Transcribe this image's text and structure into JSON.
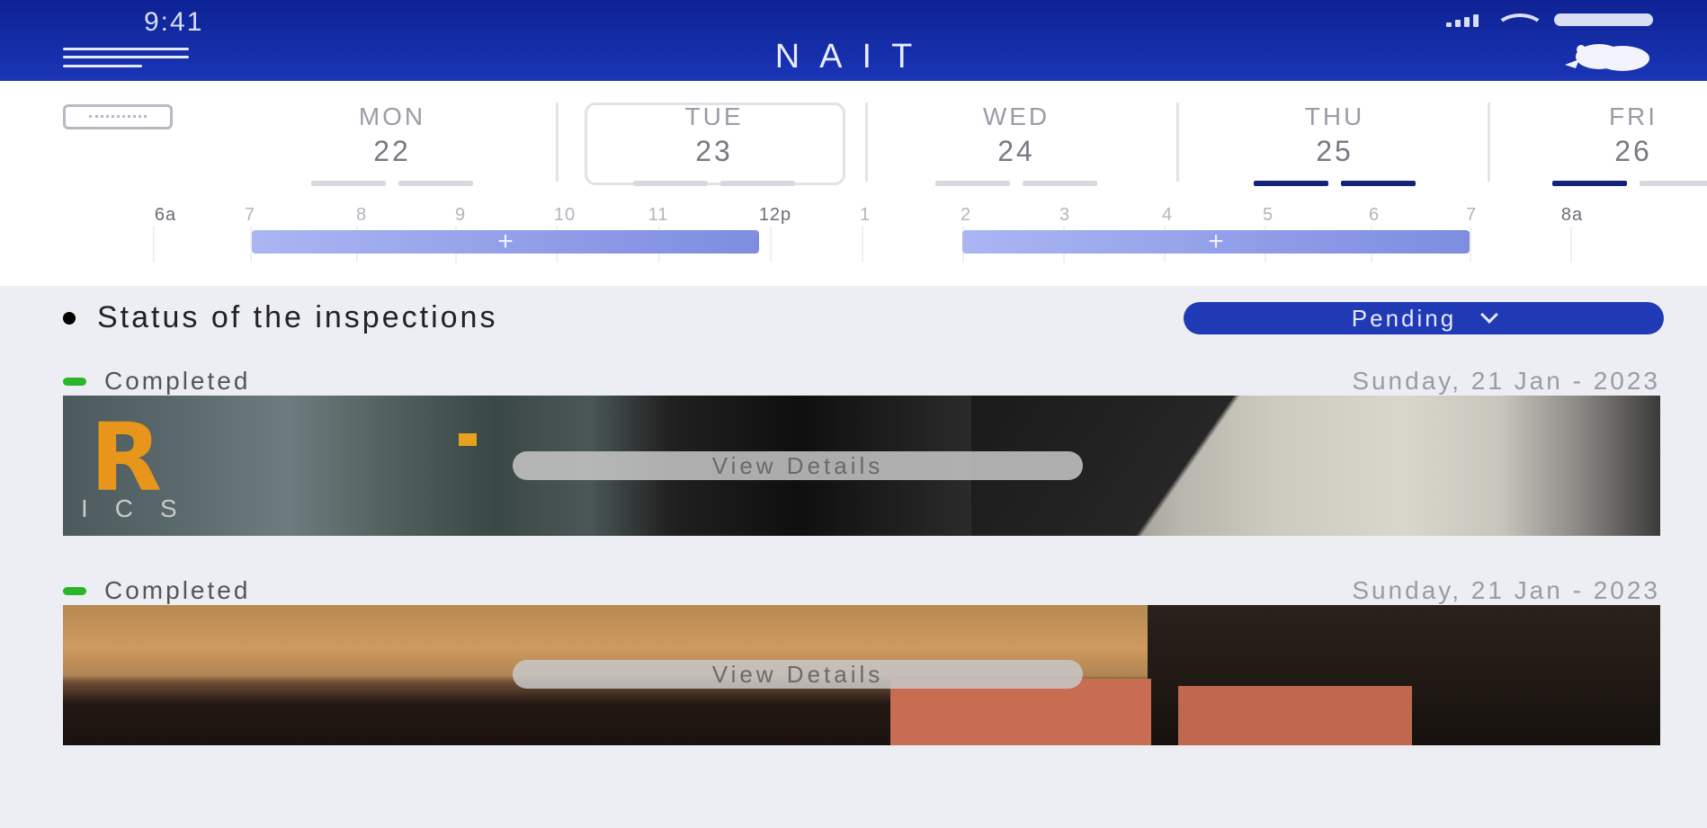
{
  "status_bar": {
    "time": "9:41"
  },
  "header": {
    "brand": "NAIT"
  },
  "calendar": {
    "days": [
      {
        "name": "MON",
        "num": "22"
      },
      {
        "name": "TUE",
        "num": "23"
      },
      {
        "name": "WED",
        "num": "24"
      },
      {
        "name": "THU",
        "num": "25"
      },
      {
        "name": "FRI",
        "num": "26"
      }
    ],
    "selected_day": "TUE",
    "hours": [
      "6a",
      "7",
      "8",
      "9",
      "10",
      "11",
      "12p",
      "1",
      "2",
      "3",
      "4",
      "5",
      "6",
      "7",
      "8a"
    ],
    "slot_plus": "+",
    "colors": {
      "accent": "#1a35b6",
      "slot": "#8a98e6",
      "bar_active": "#14237a"
    }
  },
  "inspections": {
    "title": "Status of the inspections",
    "filter_label": "Pending",
    "items": [
      {
        "state": "Completed",
        "date": "Sunday, 21 Jan - 2023",
        "action": "View Details",
        "photo_text": "R",
        "photo_subtext": "ICS"
      },
      {
        "state": "Completed",
        "date": "Sunday, 21 Jan - 2023",
        "action": "View Details"
      }
    ],
    "colors": {
      "completed": "#2bb52b",
      "filter_bg": "#2039b4"
    }
  }
}
